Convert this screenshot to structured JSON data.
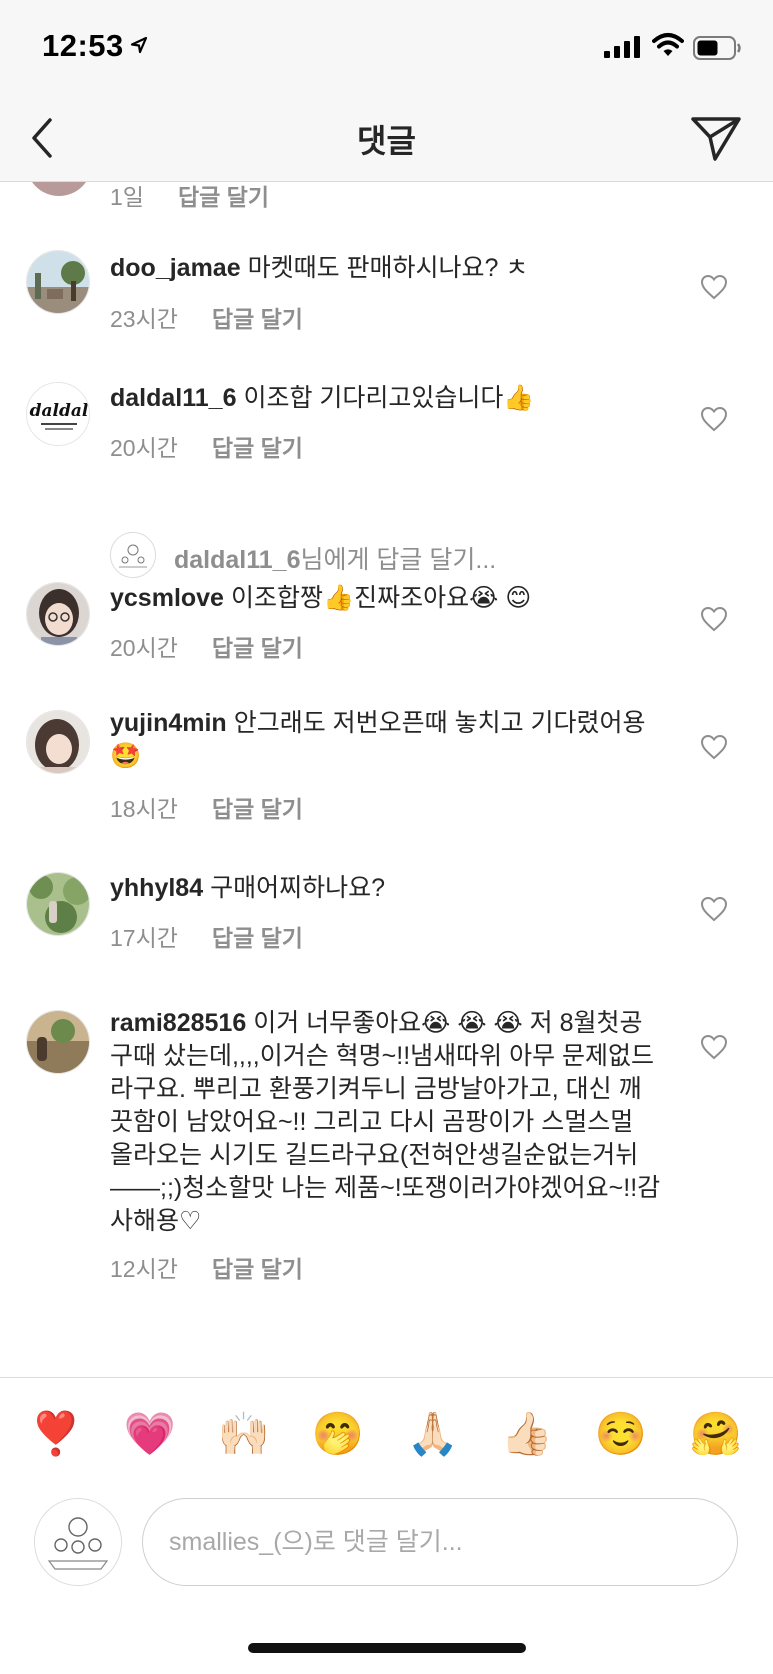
{
  "status": {
    "time": "12:53"
  },
  "header": {
    "title": "댓글"
  },
  "top_partial": {
    "time": "1일",
    "reply_label": "답글 달기"
  },
  "comments": [
    {
      "user": "doo_jamae",
      "text": "마켓때도 판매하시나요? ㅊ",
      "time": "23시간",
      "reply_label": "답글 달기"
    },
    {
      "user": "daldal11_6",
      "text": "이조합  기다리고있습니다👍",
      "time": "20시간",
      "reply_label": "답글 달기",
      "avatar_logo": "daldal"
    },
    {
      "user": "ycsmlove",
      "text": "이조합짱👍진짜조아요😭 😊",
      "time": "20시간",
      "reply_label": "답글 달기"
    },
    {
      "user": "yujin4min",
      "text": "안그래도 저번오픈때 놓치고 기다렸어용🤩",
      "time": "18시간",
      "reply_label": "답글 달기"
    },
    {
      "user": "yhhyl84",
      "text": "구매어찌하나요?",
      "time": "17시간",
      "reply_label": "답글 달기"
    },
    {
      "user": "rami828516",
      "text": "이거 너무좋아요😭 😭 😭 저 8월첫공구때 샀는데,,,,이거슨 혁명~!!냄새따위 아무 문제없드라구요. 뿌리고 환풍기켜두니 금방날아가고, 대신 깨끗함이 남았어요~!! 그리고 다시 곰팡이가 스멀스멀 올라오는 시기도 길드라구요(전혀안생길순없는거뉘——;;)청소할맛 나는 제품~!또쟁이러가야겠어요~!!감사해용♡",
      "time": "12시간",
      "reply_label": "답글 달기"
    }
  ],
  "reply_prompt": {
    "user": "daldal11_6",
    "suffix": "님에게 답글 달기..."
  },
  "emoji_bar": [
    {
      "name": "heart-exclamation",
      "char": "❣️"
    },
    {
      "name": "growing-heart",
      "char": "💗"
    },
    {
      "name": "raising-hands",
      "char": "🙌🏻"
    },
    {
      "name": "hand-over-mouth",
      "char": "🤭"
    },
    {
      "name": "folded-hands",
      "char": "🙏🏻"
    },
    {
      "name": "thumbs-up",
      "char": "👍🏻"
    },
    {
      "name": "smiling-face",
      "char": "☺️"
    },
    {
      "name": "hugging-face",
      "char": "🤗"
    }
  ],
  "compose": {
    "placeholder": "smallies_(으)로 댓글 달기..."
  },
  "colors": {
    "link_blue": "#0095f6",
    "meta_gray": "#8e8e8e",
    "text": "#262626",
    "heart_red": "#ed4956"
  }
}
